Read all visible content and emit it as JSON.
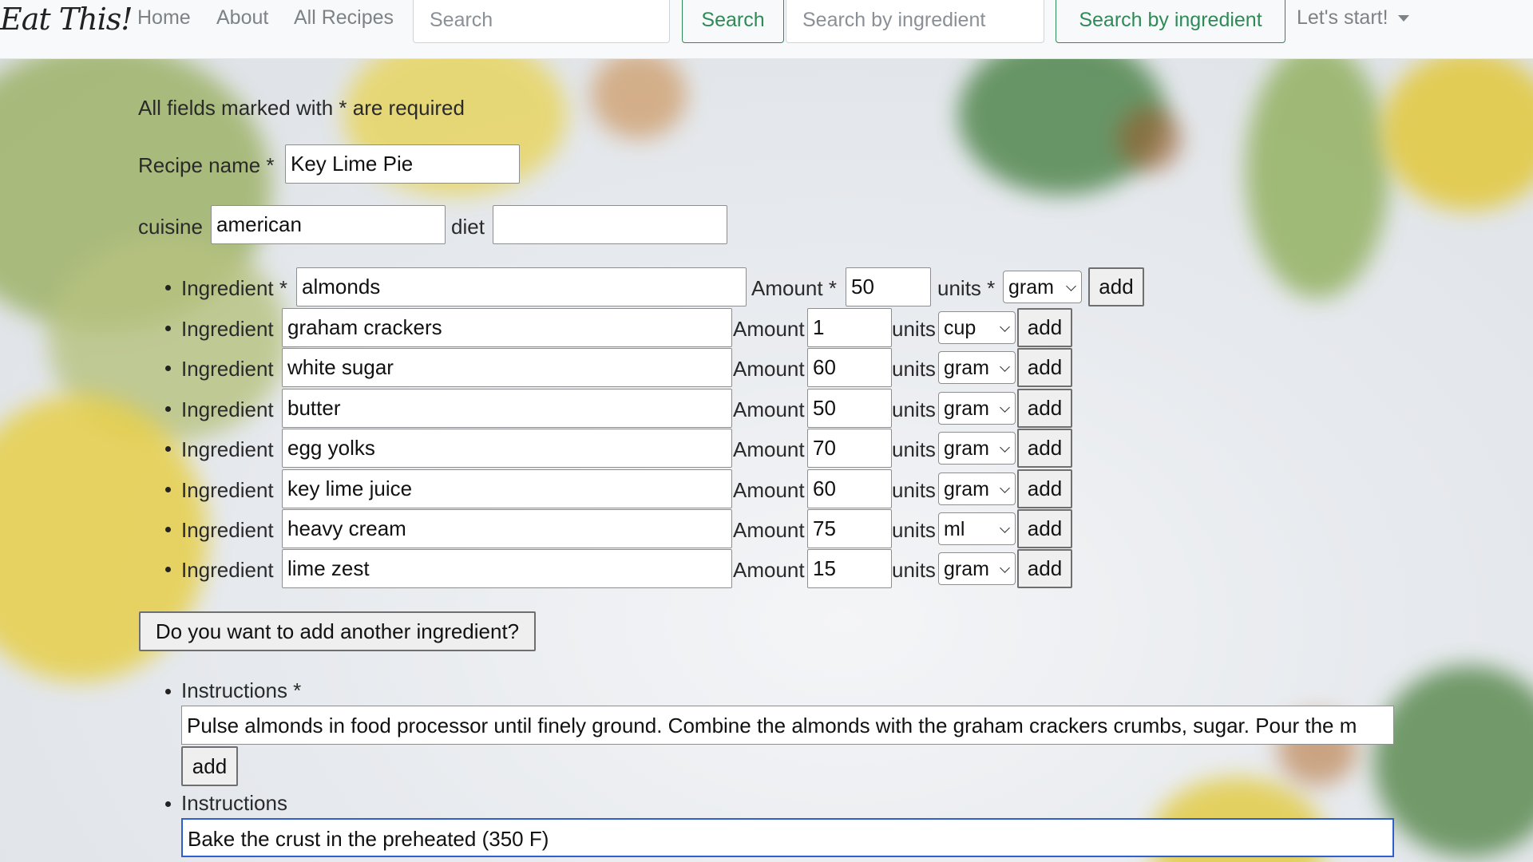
{
  "navbar": {
    "brand": "Eat This!",
    "links": [
      "Home",
      "About",
      "All Recipes"
    ],
    "search_placeholder": "Search",
    "search_button": "Search",
    "ingredient_search_placeholder": "Search by ingredient",
    "ingredient_search_button": "Search by ingredient",
    "dropdown_label": "Let's start!"
  },
  "form": {
    "required_note": "All fields marked with * are required",
    "recipe_name_label": "Recipe name *",
    "recipe_name_value": "Key Lime Pie",
    "cuisine_label": "cuisine",
    "cuisine_value": "american",
    "diet_label": "diet",
    "diet_value": "",
    "first_ingredient": {
      "ingredient_label": "Ingredient *",
      "amount_label": "Amount *",
      "units_label": "units *",
      "name": "almonds",
      "amount": "50",
      "unit": "gram",
      "add_label": "add"
    },
    "ingredient_label": "Ingredient",
    "amount_label": "Amount",
    "units_label": "units",
    "add_label": "add",
    "ingredients": [
      {
        "name": "graham crackers",
        "amount": "1",
        "unit": "cup"
      },
      {
        "name": "white sugar",
        "amount": "60",
        "unit": "gram"
      },
      {
        "name": "butter",
        "amount": "50",
        "unit": "gram"
      },
      {
        "name": "egg yolks",
        "amount": "70",
        "unit": "gram"
      },
      {
        "name": "key lime juice",
        "amount": "60",
        "unit": "gram"
      },
      {
        "name": "heavy cream",
        "amount": "75",
        "unit": "ml"
      },
      {
        "name": "lime zest",
        "amount": "15",
        "unit": "gram"
      }
    ],
    "add_another_ingredient_button": "Do you want to add another ingredient?",
    "instructions": [
      {
        "label": "Instructions *",
        "value": "Pulse almonds in food processor until finely ground. Combine the almonds with the graham crackers crumbs, sugar. Pour the m",
        "add_label": "add"
      },
      {
        "label": "Instructions",
        "value": "Bake the crust in the preheated (350 F)"
      }
    ]
  },
  "colors": {
    "nav_accent": "#2e8b57",
    "focus_border": "#2f5fcf"
  },
  "icons": {
    "dropdown": "caret-down-icon",
    "select": "chevron-down-icon"
  }
}
